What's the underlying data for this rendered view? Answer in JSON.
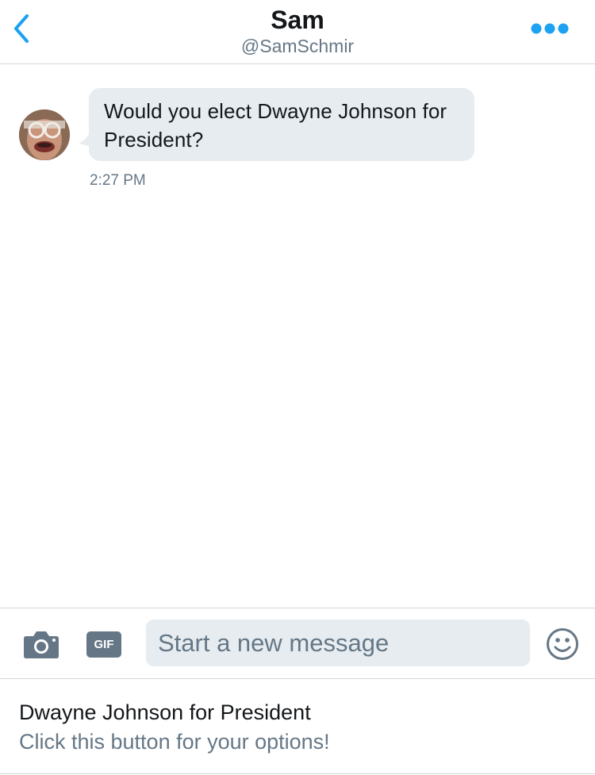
{
  "colors": {
    "accent": "#1da1f2",
    "icon_gray": "#657786",
    "bubble_bg": "#e6ecf0",
    "text_primary": "#14171a",
    "text_secondary": "#657786",
    "divider": "#d3d6da"
  },
  "header": {
    "back_icon": "chevron-left-icon",
    "title": "Sam",
    "handle": "@SamSchmir",
    "more_icon": "more-dots-icon"
  },
  "conversation": {
    "messages": [
      {
        "sender": "avatar",
        "text": "Would you elect Dwayne Johnson for President?",
        "time": "2:27 PM"
      }
    ]
  },
  "composer": {
    "camera_icon": "camera-icon",
    "gif_label": "GIF",
    "placeholder": "Start a new message",
    "value": "",
    "emoji_icon": "smiley-icon"
  },
  "quick_reply": {
    "title": "Dwayne Johnson for President",
    "subtitle": "Click this button for your options!"
  }
}
